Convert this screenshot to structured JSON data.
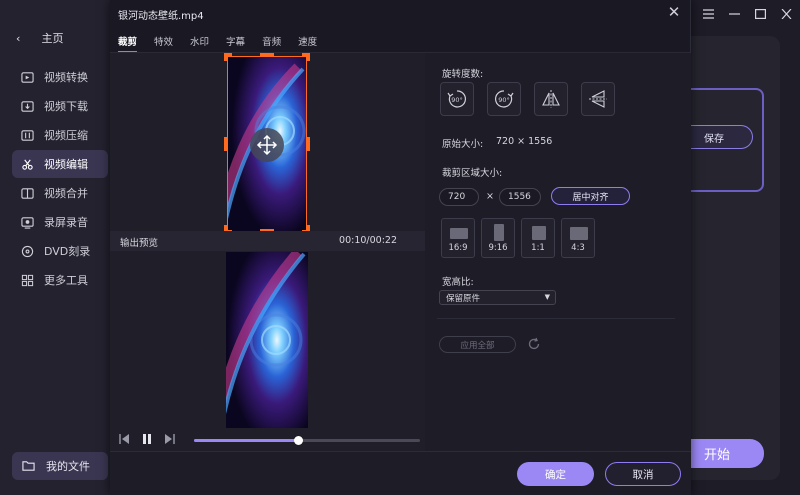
{
  "sidebar": {
    "home_label": "主页",
    "items": [
      {
        "label": "视频转换",
        "icon": "video-convert-icon"
      },
      {
        "label": "视频下载",
        "icon": "download-icon"
      },
      {
        "label": "视频压缩",
        "icon": "compress-icon"
      },
      {
        "label": "视频编辑",
        "icon": "scissors-icon",
        "active": true
      },
      {
        "label": "视频合并",
        "icon": "merge-icon"
      },
      {
        "label": "录屏录音",
        "icon": "record-icon"
      },
      {
        "label": "DVD刻录",
        "icon": "dvd-icon"
      },
      {
        "label": "更多工具",
        "icon": "grid-icon"
      }
    ],
    "files_label": "我的文件"
  },
  "background": {
    "save_label": "保存",
    "start_label": "开始"
  },
  "dialog": {
    "title": "银河动态壁纸.mp4",
    "tabs": [
      "裁剪",
      "特效",
      "水印",
      "字幕",
      "音频",
      "速度"
    ],
    "active_tab": "裁剪",
    "preview": {
      "output_label": "输出预览",
      "time": "00:10/00:22",
      "progress": 0.46
    },
    "settings": {
      "rotation_label": "旋转度数:",
      "rotate_left_label": "90°",
      "rotate_right_label": "90°",
      "original_size_label": "原始大小:",
      "original_size_value": "720 × 1556",
      "crop_area_label": "裁剪区域大小:",
      "crop_width": "720",
      "crop_x": "×",
      "crop_height": "1556",
      "center_label": "居中对齐",
      "ratios": [
        "16:9",
        "9:16",
        "1:1",
        "4:3"
      ],
      "aspect_label": "宽高比:",
      "aspect_value": "保留原件",
      "apply_all_label": "应用全部"
    },
    "ok_label": "确定",
    "cancel_label": "取消"
  },
  "colors": {
    "accent": "#9c88f5",
    "crop_border": "#ff6a1f",
    "background": "#1d1c27"
  }
}
